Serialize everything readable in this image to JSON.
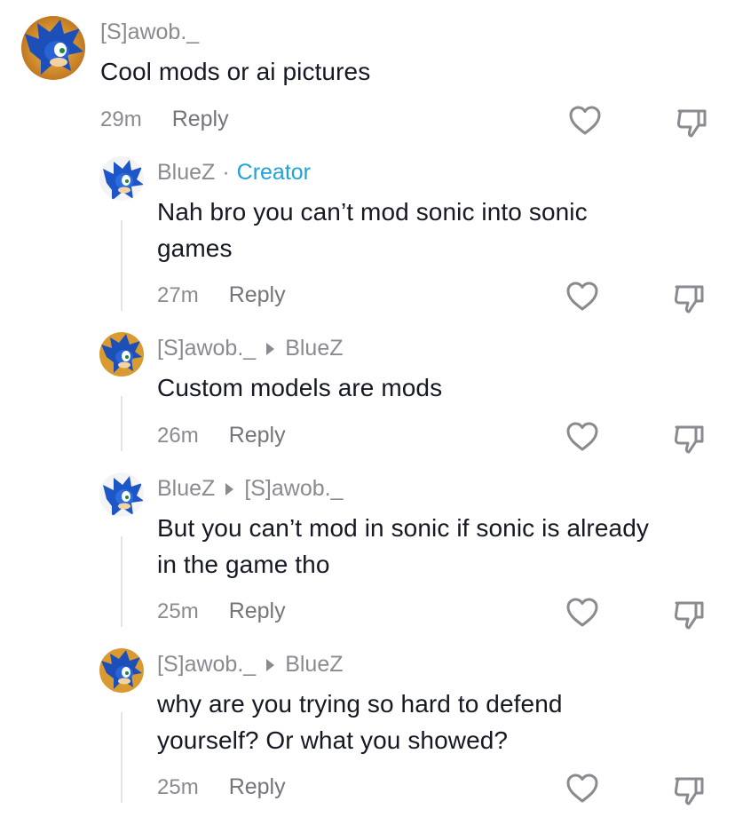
{
  "comments": [
    {
      "user": "[S]awob._",
      "avatar": "sonic-avatar-blue",
      "text": "Cool mods or ai pictures",
      "time": "29m",
      "reply": "Reply"
    },
    {
      "user": "BlueZ",
      "badge_sep": "·",
      "badge": "Creator",
      "avatar": "sonic-avatar-white",
      "text": "Nah bro you can’t mod sonic into sonic\ngames",
      "time": "27m",
      "reply": "Reply"
    },
    {
      "user": "[S]awob._",
      "reply_to": "BlueZ",
      "avatar": "sonic-avatar-blue",
      "text": "Custom models are mods",
      "time": "26m",
      "reply": "Reply"
    },
    {
      "user": "BlueZ",
      "reply_to": "[S]awob._",
      "avatar": "sonic-avatar-white",
      "text": "But you can’t mod in sonic if sonic is already\nin the game tho",
      "time": "25m",
      "reply": "Reply"
    },
    {
      "user": "[S]awob._",
      "reply_to": "BlueZ",
      "avatar": "sonic-avatar-blue",
      "text": "why are you trying so hard to defend\nyourself? Or what you showed?",
      "time": "25m",
      "reply": "Reply"
    }
  ],
  "colors": {
    "creator_badge": "#20a3d6",
    "muted_text": "#8a8b91",
    "primary_text": "#161823"
  }
}
